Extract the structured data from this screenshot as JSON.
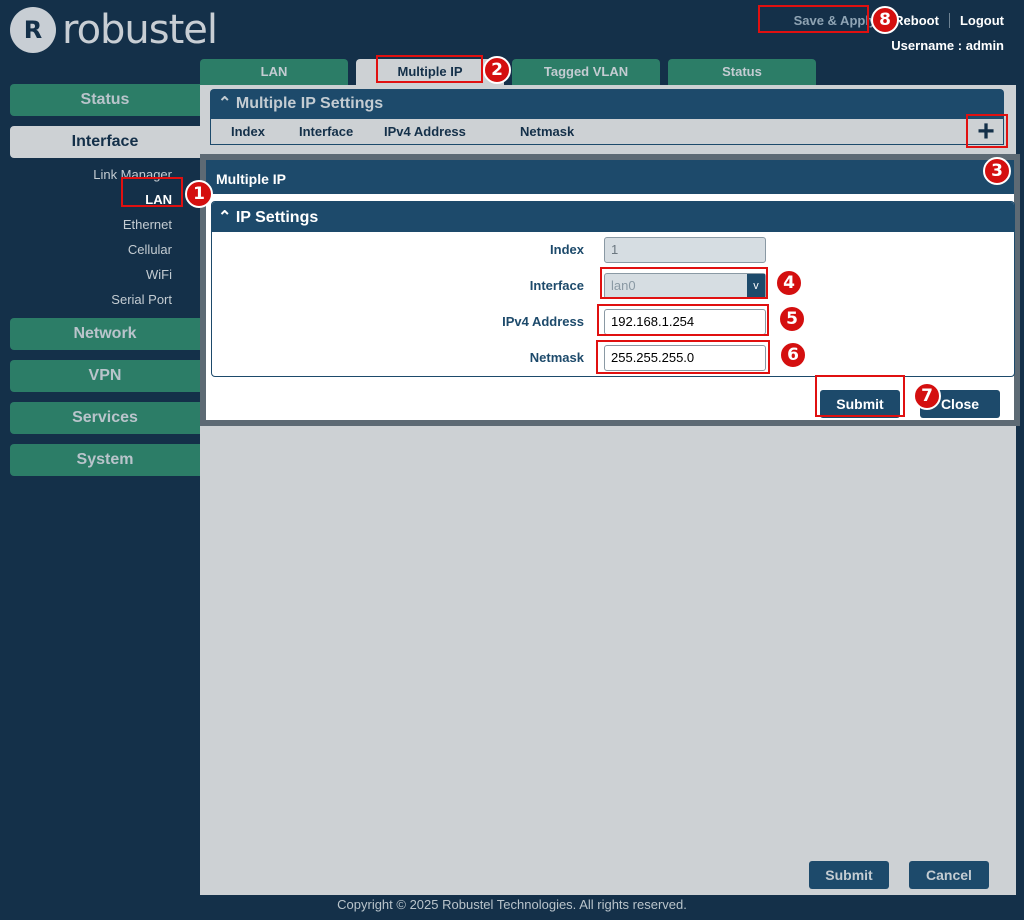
{
  "logo": {
    "mark": "R",
    "text": "robustel"
  },
  "top_links": {
    "save_apply": "Save & Apply",
    "reboot": "Reboot",
    "logout": "Logout",
    "username": "Username : admin"
  },
  "sidebar": {
    "status": "Status",
    "interface": "Interface",
    "interface_items": [
      "Link Manager",
      "LAN",
      "Ethernet",
      "Cellular",
      "WiFi",
      "Serial Port"
    ],
    "network": "Network",
    "vpn": "VPN",
    "services": "Services",
    "system": "System"
  },
  "tabs": [
    "LAN",
    "Multiple IP",
    "Tagged VLAN",
    "Status"
  ],
  "multiple_ip_panel": {
    "title": "Multiple IP Settings",
    "columns": [
      "Index",
      "Interface",
      "IPv4 Address",
      "Netmask"
    ],
    "add_icon": "+"
  },
  "modal": {
    "title": "Multiple IP",
    "section_title": "IP Settings",
    "fields": {
      "index": {
        "label": "Index",
        "value": "1"
      },
      "interface": {
        "label": "Interface",
        "value": "lan0"
      },
      "ipv4": {
        "label": "IPv4 Address",
        "value": "192.168.1.254"
      },
      "netmask": {
        "label": "Netmask",
        "value": "255.255.255.0"
      }
    },
    "submit": "Submit",
    "close": "Close"
  },
  "main_buttons": {
    "submit": "Submit",
    "cancel": "Cancel"
  },
  "footer": "Copyright © 2025 Robustel Technologies. All rights reserved.",
  "callouts": [
    "1",
    "2",
    "3",
    "4",
    "5",
    "6",
    "7",
    "8"
  ],
  "colors": {
    "background": "#143049",
    "accent_green": "#2c7d67",
    "panel_blue": "#1d4a6b",
    "content_gray": "#cdd1d4",
    "callout_red": "#d40f0f"
  }
}
